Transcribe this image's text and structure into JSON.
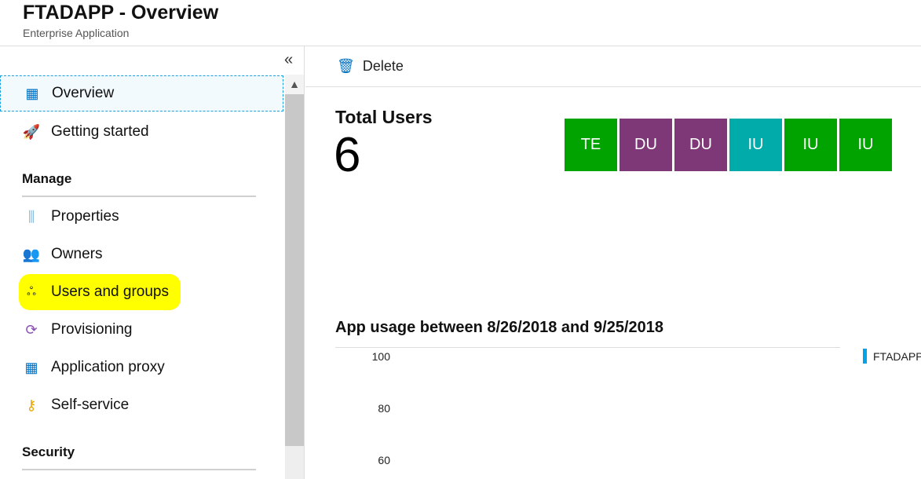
{
  "header": {
    "title": "FTADAPP - Overview",
    "subtitle": "Enterprise Application"
  },
  "sidebar": {
    "collapse_icon": "«",
    "items": [
      {
        "label": "Overview",
        "icon": "grid-globe-icon"
      },
      {
        "label": "Getting started",
        "icon": "rocket-icon"
      },
      {
        "label": "Properties",
        "icon": "sliders-icon"
      },
      {
        "label": "Owners",
        "icon": "owners-icon"
      },
      {
        "label": "Users and groups",
        "icon": "users-icon"
      },
      {
        "label": "Provisioning",
        "icon": "provisioning-icon"
      },
      {
        "label": "Application proxy",
        "icon": "app-proxy-icon"
      },
      {
        "label": "Self-service",
        "icon": "key-icon"
      }
    ],
    "sections": {
      "manage": "Manage",
      "security": "Security"
    }
  },
  "toolbar": {
    "delete_label": "Delete"
  },
  "users": {
    "label": "Total Users",
    "count": "6",
    "tiles": [
      {
        "initials": "TE",
        "color": "#00a300"
      },
      {
        "initials": "DU",
        "color": "#7e3878"
      },
      {
        "initials": "DU",
        "color": "#7e3878"
      },
      {
        "initials": "IU",
        "color": "#00aba9"
      },
      {
        "initials": "IU",
        "color": "#00a300"
      },
      {
        "initials": "IU",
        "color": "#00a300"
      }
    ]
  },
  "chart_data": {
    "type": "line",
    "title": "App usage between 8/26/2018 and 9/25/2018",
    "yticks": [
      "100",
      "80",
      "60"
    ],
    "legend": [
      "FTADAPP"
    ],
    "series": [
      {
        "name": "FTADAPP",
        "color": "#00a2e8",
        "values": []
      }
    ]
  }
}
